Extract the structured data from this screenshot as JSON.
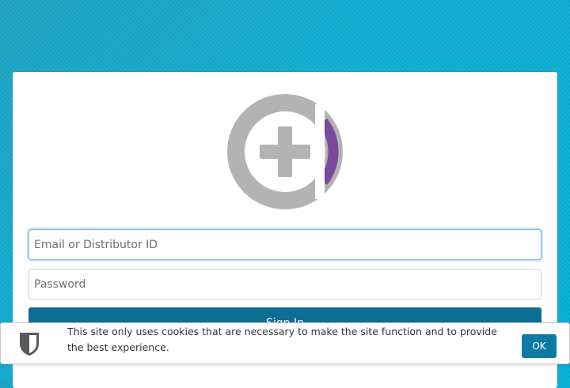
{
  "login": {
    "email_placeholder": "Email or Distributor ID",
    "password_placeholder": "Password",
    "signin_label": "Sign In"
  },
  "logo": {
    "icon": "plus-in-circle-logo",
    "colors": {
      "gray": "#b3b3b3",
      "purple": "#7b4a9d"
    }
  },
  "cookie_banner": {
    "text": "This site only uses cookies that are necessary to make the site function and to provide the best experience.",
    "ok_label": "OK",
    "icon": "shield-icon"
  },
  "colors": {
    "background": "#10acd1",
    "primary_button": "#0c6e93",
    "ok_button": "#0d7aa3"
  }
}
